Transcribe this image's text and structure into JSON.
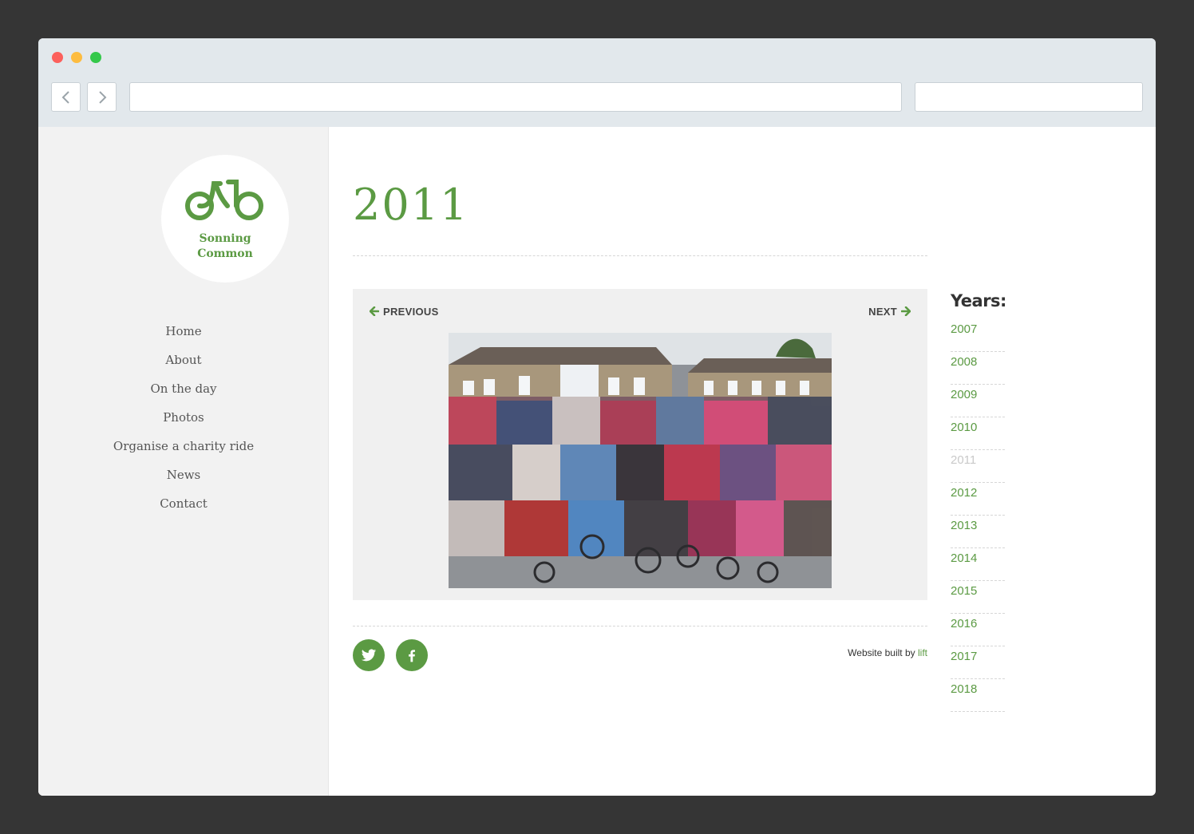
{
  "brand": {
    "logo_line1": "Sonning",
    "logo_line2": "Common",
    "color_primary": "#5b9a43"
  },
  "nav": {
    "items": [
      "Home",
      "About",
      "On the day",
      "Photos",
      "Organise a charity ride",
      "News",
      "Contact"
    ]
  },
  "page": {
    "title": "2011"
  },
  "gallery": {
    "previous_label": "PREVIOUS",
    "next_label": "NEXT"
  },
  "years": {
    "heading": "Years:",
    "items": [
      "2007",
      "2008",
      "2009",
      "2010",
      "2011",
      "2012",
      "2013",
      "2014",
      "2015",
      "2016",
      "2017",
      "2018"
    ],
    "current": "2011"
  },
  "footer": {
    "credit_prefix": "Website built by",
    "credit_link": "lift",
    "social_icons": [
      "twitter-icon",
      "facebook-icon"
    ]
  }
}
